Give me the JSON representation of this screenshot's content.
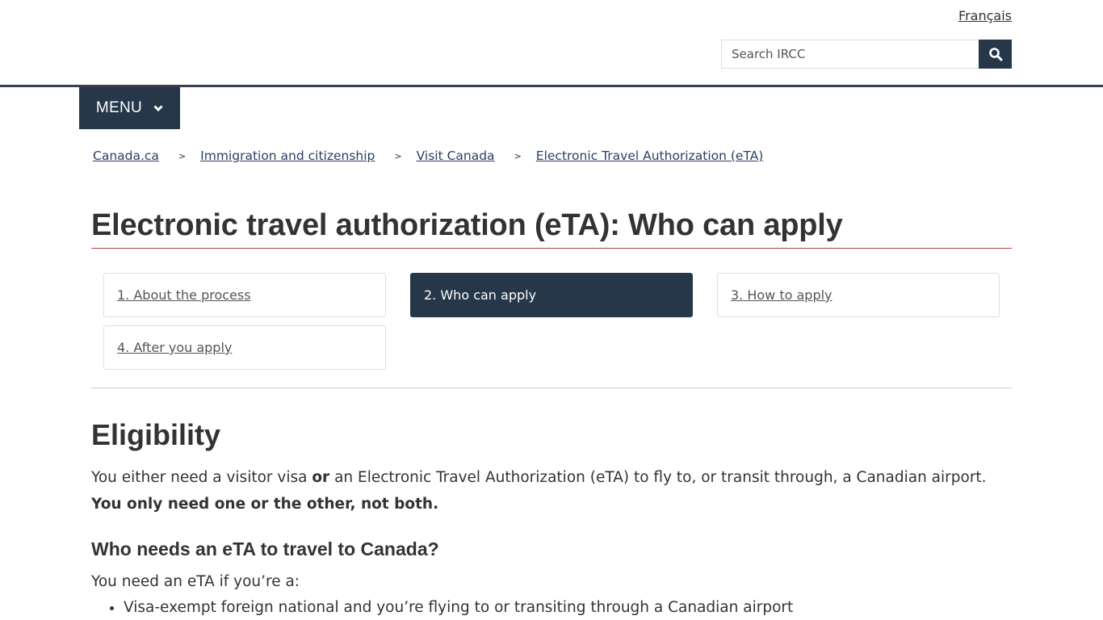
{
  "header": {
    "language_link": "Français",
    "search_placeholder": "Search IRCC",
    "search_icon": "magnifier-icon",
    "menu_label": "MENU",
    "menu_icon": "chevron-down-icon"
  },
  "breadcrumb": [
    {
      "label": "Canada.ca"
    },
    {
      "label": "Immigration and citizenship"
    },
    {
      "label": "Visit Canada"
    },
    {
      "label": "Electronic Travel Authorization (eTA)"
    }
  ],
  "breadcrumb_separator": ">",
  "page_title": "Electronic travel authorization (eTA): Who can apply",
  "steps": [
    {
      "label": "1. About the process",
      "active": false
    },
    {
      "label": "2. Who can apply",
      "active": true
    },
    {
      "label": "3. How to apply",
      "active": false
    },
    {
      "label": "4. After you apply",
      "active": false
    }
  ],
  "content": {
    "heading": "Eligibility",
    "para1_before": "You either need a visitor visa ",
    "para1_bold": "or",
    "para1_after": " an Electronic Travel Authorization (eTA) to fly to, or transit through, a Canadian airport.",
    "para1_strong_line": "You only need one or the other, not both.",
    "subheading": "Who needs an eTA to travel to Canada?",
    "para2": "You need an eTA if you’re a:",
    "list": [
      "Visa-exempt foreign national and you’re flying to or transiting through a Canadian airport"
    ]
  },
  "colors": {
    "brand_dark": "#26374a",
    "title_rule": "#af3c43",
    "link": "#284162"
  }
}
